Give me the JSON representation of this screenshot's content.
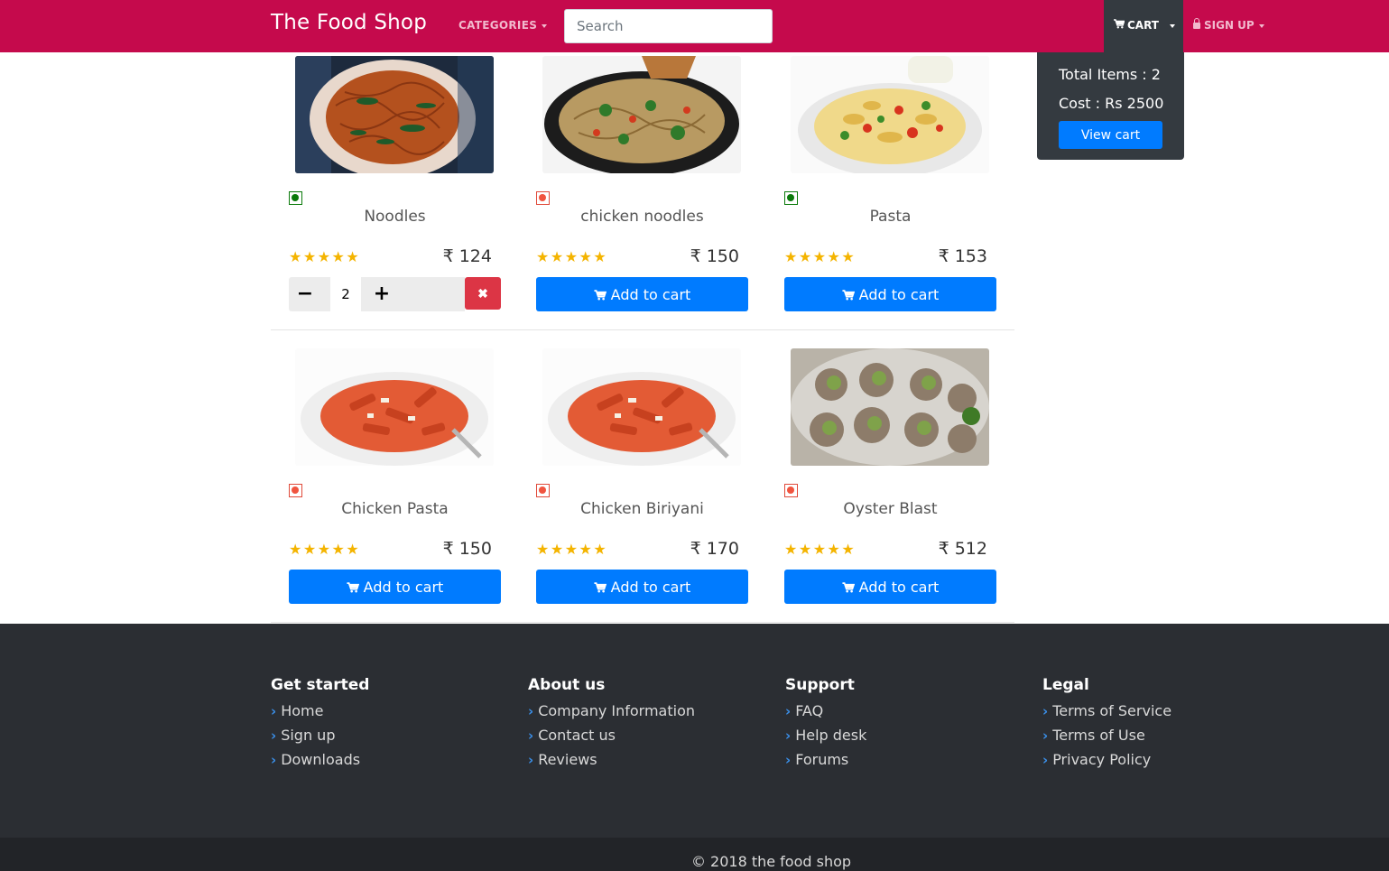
{
  "navbar": {
    "brand": "The Food Shop",
    "categories_label": "CATEGORIES",
    "search_placeholder": "Search",
    "cart_label": "CART",
    "signup_label": "SIGN UP",
    "bg_color": "#c50a4c"
  },
  "cart_dropdown": {
    "total_items": "Total Items : 2",
    "cost": "Cost : Rs 2500",
    "view_cart_label": "View cart"
  },
  "products": [
    {
      "name": "Noodles",
      "price": "₹ 124",
      "stars": "★★★★★",
      "diet": "veg",
      "in_cart": true,
      "quantity": "2",
      "image": "noodles"
    },
    {
      "name": "chicken noodles",
      "price": "₹ 150",
      "stars": "★★★★★",
      "diet": "non-veg",
      "in_cart": false,
      "image": "chicken-noodles"
    },
    {
      "name": "Pasta",
      "price": "₹ 153",
      "stars": "★★★★★",
      "diet": "veg",
      "in_cart": false,
      "image": "pasta-salad"
    },
    {
      "name": "Chicken Pasta",
      "price": "₹ 150",
      "stars": "★★★★★",
      "diet": "non-veg",
      "in_cart": false,
      "image": "penne-arrabbiata"
    },
    {
      "name": "Chicken Biriyani",
      "price": "₹ 170",
      "stars": "★★★★★",
      "diet": "non-veg",
      "in_cart": false,
      "image": "penne-arrabbiata"
    },
    {
      "name": "Oyster Blast",
      "price": "₹ 512",
      "stars": "★★★★★",
      "diet": "non-veg",
      "in_cart": false,
      "image": "escargot"
    }
  ],
  "buttons": {
    "add_to_cart": "Add to cart",
    "minus": "−",
    "plus": "+",
    "remove": "✖"
  },
  "footer": {
    "columns": [
      {
        "title": "Get started",
        "links": [
          "Home",
          "Sign up",
          "Downloads"
        ]
      },
      {
        "title": "About us",
        "links": [
          "Company Information",
          "Contact us",
          "Reviews"
        ]
      },
      {
        "title": "Support",
        "links": [
          "FAQ",
          "Help desk",
          "Forums"
        ]
      },
      {
        "title": "Legal",
        "links": [
          "Terms of Service",
          "Terms of Use",
          "Privacy Policy"
        ]
      }
    ],
    "copyright": "© 2018 the food shop"
  },
  "colors": {
    "primary": "#007bff",
    "danger": "#dc3545",
    "dark": "#343a40",
    "star": "#f4b400",
    "veg": "#0a7a0a",
    "non_veg": "#f0543f"
  },
  "icons": {
    "cart": "shopping-cart-icon",
    "lock": "lock-icon",
    "chevron": "chevron-right-icon"
  }
}
